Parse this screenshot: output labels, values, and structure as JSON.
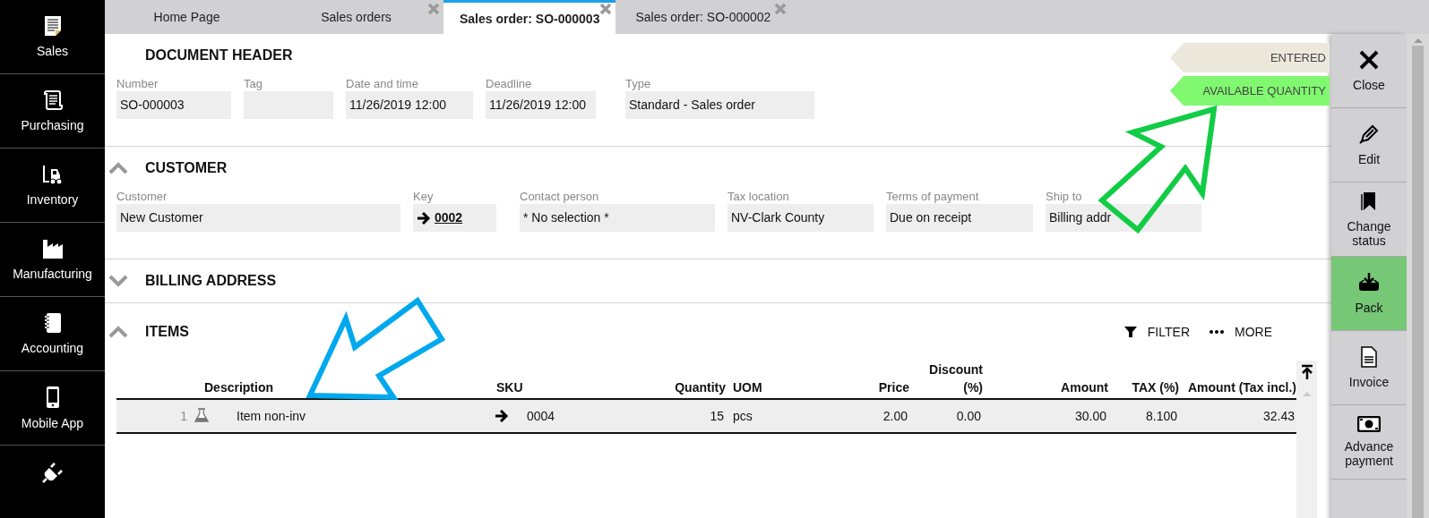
{
  "sidebar": {
    "items": [
      {
        "kind": "sales",
        "label": "Sales"
      },
      {
        "kind": "purchasing",
        "label": "Purchasing"
      },
      {
        "kind": "inventory",
        "label": "Inventory"
      },
      {
        "kind": "manufacturing",
        "label": "Manufacturing"
      },
      {
        "kind": "accounting",
        "label": "Accounting"
      },
      {
        "kind": "mobile",
        "label": "Mobile App"
      },
      {
        "kind": "plugin"
      }
    ]
  },
  "tabs": [
    {
      "label": "Home Page",
      "selected": false,
      "closable": false
    },
    {
      "label": "Sales orders",
      "selected": false,
      "closable": true
    },
    {
      "label": "Sales order: SO-000003",
      "selected": true,
      "closable": true
    },
    {
      "label": "Sales order: SO-000002",
      "selected": false,
      "closable": true
    }
  ],
  "status_tags": [
    {
      "label": "ENTERED",
      "color": "#ece8dc"
    },
    {
      "label": "AVAILABLE QUANTITY",
      "color": "#80f870"
    }
  ],
  "document_header": {
    "title": "DOCUMENT HEADER",
    "fields": [
      {
        "label": "Number",
        "value": "SO-000003",
        "kind": "text"
      },
      {
        "label": "Tag",
        "kind": "text"
      },
      {
        "label": "Date and time",
        "value": "11/26/2019 12:00",
        "kind": "text"
      },
      {
        "label": "Deadline",
        "value": "11/26/2019 12:00",
        "kind": "text"
      },
      {
        "label": "Type",
        "value": "Standard - Sales order",
        "kind": "text"
      }
    ]
  },
  "customer": {
    "title": "CUSTOMER",
    "expanded": true,
    "fields": [
      {
        "label": "Customer",
        "value": "New Customer",
        "kind": "text"
      },
      {
        "label": "Key",
        "value": "0002",
        "kind": "link"
      },
      {
        "label": "Contact person",
        "value": "* No selection *",
        "kind": "text"
      },
      {
        "label": "Tax location",
        "value": "NV-Clark County",
        "kind": "text"
      },
      {
        "label": "Terms of payment",
        "value": "Due on receipt",
        "kind": "text"
      },
      {
        "label": "Ship to",
        "value": "Billing addr",
        "kind": "text"
      }
    ]
  },
  "billing_address": {
    "title": "BILLING ADDRESS",
    "expanded": false
  },
  "items": {
    "title": "ITEMS",
    "expanded": true,
    "toolbar": [
      {
        "kind": "filter",
        "label": "FILTER"
      },
      {
        "kind": "more",
        "label": "MORE"
      }
    ],
    "columns": [
      "Description",
      "SKU",
      "Quantity",
      "UOM",
      "Price",
      "Discount (%)",
      "Amount",
      "TAX (%)",
      "Amount (Tax incl.)"
    ],
    "rows": [
      {
        "number": "1",
        "kind": "non-inventory",
        "description": "Item non-inv",
        "sku": "0004",
        "quantity": "15",
        "uom": "pcs",
        "price": "2.00",
        "discount": "0.00",
        "amount": "30.00",
        "tax": "8.100",
        "amount_tax_incl": "32.43"
      }
    ]
  },
  "actions": [
    {
      "kind": "close",
      "label": "Close",
      "highlighted": false
    },
    {
      "kind": "edit",
      "label": "Edit",
      "highlighted": false
    },
    {
      "kind": "status",
      "label": "Change status",
      "highlighted": false
    },
    {
      "kind": "pack",
      "label": "Pack",
      "highlighted": true
    },
    {
      "kind": "invoice",
      "label": "Invoice",
      "highlighted": false
    },
    {
      "kind": "advance",
      "label": "Advance payment",
      "highlighted": false
    }
  ]
}
